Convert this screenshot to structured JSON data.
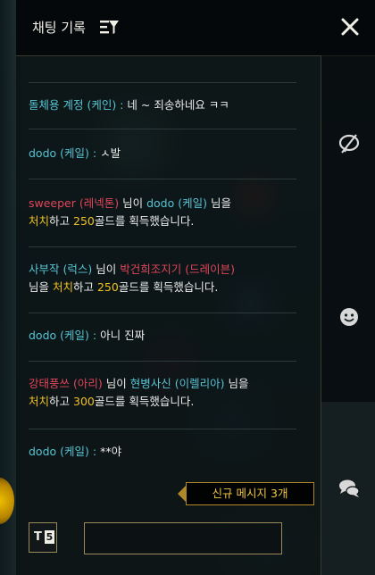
{
  "header": {
    "title": "채팅 기록"
  },
  "messages": [
    {
      "sender": "돌체용 계정",
      "champion": "(케인)",
      "colon": " : ",
      "text": "네 ~ 죄송하네요 ㅋㅋ"
    },
    {
      "sender": "dodo",
      "champion": "(케일)",
      "colon": " : ",
      "text": "ㅅ발"
    },
    {
      "killer": "sweeper",
      "killer_champ": "(레넥톤)",
      "joiner": " 님이 ",
      "victim": "dodo",
      "victim_champ": "(케일)",
      "line1_end": " 님을",
      "kill_word": "처치",
      "mid": "하고 ",
      "gold": "250",
      "end": "골드를 획득했습니다."
    },
    {
      "killer": "사부작",
      "killer_champ": "(럭스)",
      "joiner": " 님이 ",
      "victim": "박건희조지기",
      "victim_champ": "(드레이븐)",
      "line2_start": "님을 ",
      "kill_word": "처치",
      "mid": "하고 ",
      "gold": "250",
      "end": "골드를 획득했습니다."
    },
    {
      "sender": "dodo",
      "champion": "(케일)",
      "colon": " : ",
      "text": "아니 진짜"
    },
    {
      "killer": "강태풍쓰",
      "killer_champ": "(아리)",
      "joiner": " 님이 ",
      "victim": "현병사신",
      "victim_champ": "(이렐리아)",
      "line1_end": " 님을",
      "kill_word": "처치",
      "mid": "하고 ",
      "gold": "300",
      "end": "골드를 획득했습니다."
    },
    {
      "sender": "dodo",
      "champion": "(케일)",
      "colon": " : ",
      "text": "**야"
    }
  ],
  "new_message_notice": "신규 메시지 3개",
  "chat_mode_button": {
    "letter": "T",
    "number": "5"
  },
  "input": {
    "value": ""
  },
  "colors": {
    "ally": "#57c4d4",
    "enemy": "#e0465a",
    "champion_orange": "#e6a24a",
    "gold": "#f0c020",
    "border": "#9a8a5a"
  },
  "icons": [
    "filter-icon",
    "close-icon",
    "mute-ping-icon",
    "emote-icon",
    "chat-bubbles-icon"
  ]
}
